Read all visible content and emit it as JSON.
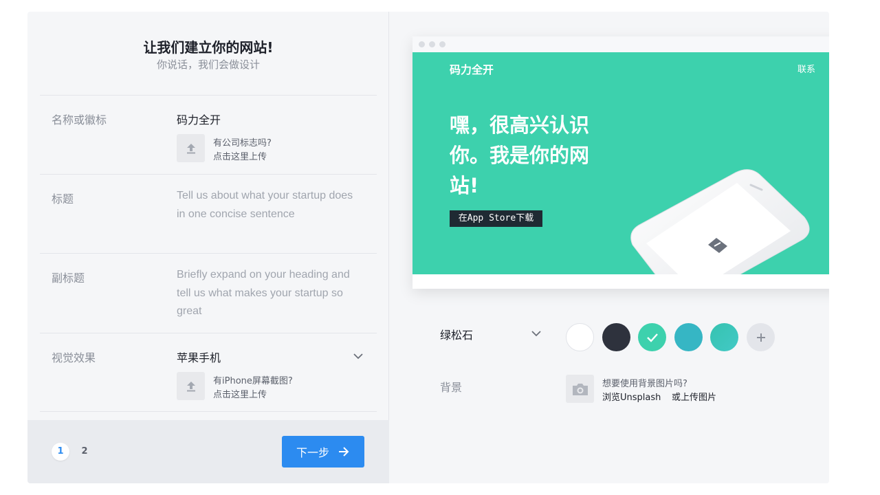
{
  "form": {
    "title": "让我们建立你的网站!",
    "subtitle": "你说话，我们会做设计",
    "rows": [
      {
        "label": "名称或徽标",
        "value": "码力全开",
        "upload_q": "有公司标志吗?",
        "upload_a": "点击这里上传"
      },
      {
        "label": "标题",
        "placeholder": "Tell us about what your startup does in one concise sentence"
      },
      {
        "label": "副标题",
        "placeholder": "Briefly expand on your heading and tell us what makes your startup so great"
      },
      {
        "label": "视觉效果",
        "value": "苹果手机",
        "upload_q": "有iPhone屏幕截图?",
        "upload_a": "点击这里上传"
      }
    ]
  },
  "footer": {
    "steps": [
      "1",
      "2"
    ],
    "next_label": "下一步"
  },
  "preview": {
    "brand": "码力全开",
    "contact": "联系",
    "headline": "嘿，很高兴认识你。我是你的网站!",
    "cta": "在App Store下载",
    "hero_color": "#3dd1ad"
  },
  "theme": {
    "color_name": "绿松石",
    "swatches": [
      {
        "name": "white",
        "color": "#ffffff"
      },
      {
        "name": "dark",
        "color": "#2e323d"
      },
      {
        "name": "turquoise",
        "color": "#3dd1ad",
        "selected": true
      },
      {
        "name": "teal",
        "color": "#36b6c4"
      },
      {
        "name": "gradient",
        "color": "#3ec7b4"
      },
      {
        "name": "add",
        "color": "#e3e5ea"
      }
    ]
  },
  "background": {
    "label": "背景",
    "question": "想要使用背景图片吗?",
    "link1": "浏览Unsplash",
    "link2": "或上传图片"
  }
}
